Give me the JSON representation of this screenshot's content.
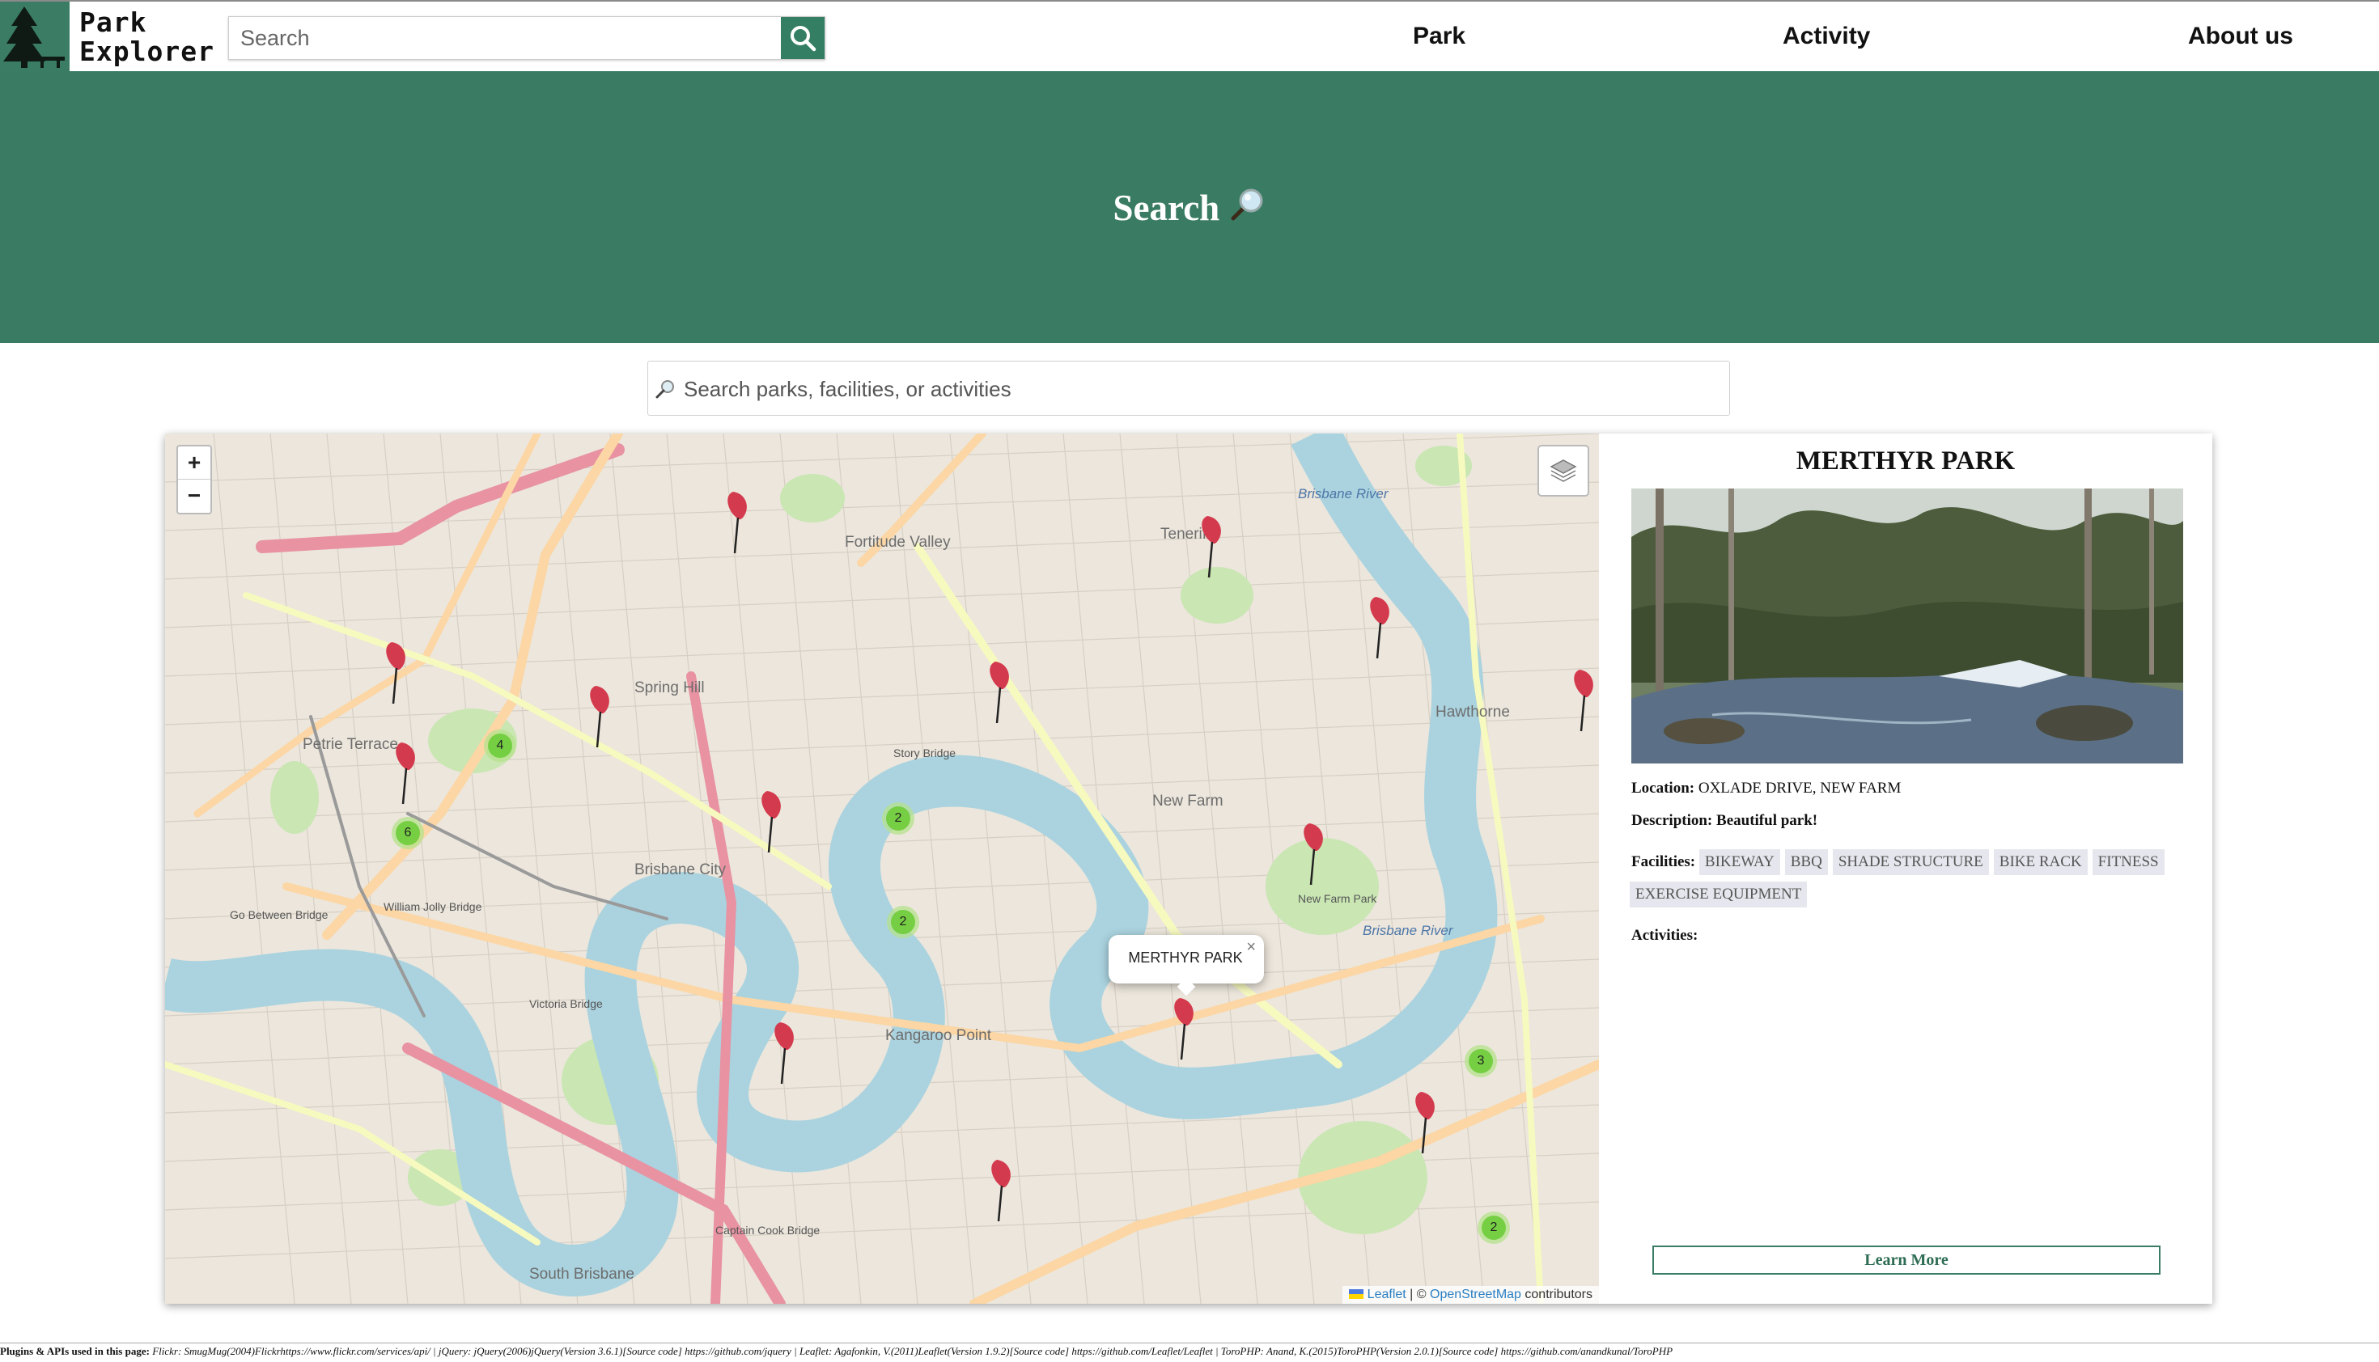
{
  "brand": {
    "line1": "Park",
    "line2": "Explorer"
  },
  "nav": {
    "search_placeholder": "Search",
    "links": [
      "Park",
      "Activity",
      "About us"
    ]
  },
  "hero": {
    "title": "Search"
  },
  "main_search": {
    "placeholder": "Search parks, facilities, or activities"
  },
  "map": {
    "zoom_in": "+",
    "zoom_out": "−",
    "attribution_leaflet": "Leaflet",
    "attribution_sep": " | © ",
    "attribution_osm": "OpenStreetMap",
    "attribution_tail": " contributors",
    "popup_title": "MERTHYR PARK",
    "popup_close": "×",
    "clusters": [
      "4",
      "6",
      "2",
      "2",
      "3",
      "2"
    ],
    "place_labels": {
      "fortitude_valley": "Fortitude Valley",
      "spring_hill": "Spring Hill",
      "petrie_terrace": "Petrie Terrace",
      "brisbane_city": "Brisbane City",
      "new_farm": "New Farm",
      "kangaroo_point": "Kangaroo Point",
      "south_brisbane": "South Brisbane",
      "hawthorne": "Hawthorne",
      "teneriffe": "Teneriffe",
      "brisbane_river": "Brisbane River",
      "story_bridge": "Story Bridge",
      "captain_cook_bridge": "Captain Cook Bridge",
      "victoria_bridge": "Victoria Bridge",
      "william_jolly_bridge": "William Jolly Bridge",
      "go_between_bridge": "Go Between Bridge",
      "new_farm_park": "New Farm Park"
    }
  },
  "panel": {
    "park_name": "MERTHYR PARK",
    "location_label": "Location:",
    "location_value": " OXLADE DRIVE, NEW FARM",
    "description_label": "Description:",
    "description_value": " Beautiful park!",
    "facilities_label": "Facilities:",
    "facilities": [
      "BIKEWAY",
      "BBQ",
      "SHADE STRUCTURE",
      "BIKE RACK",
      "FITNESS",
      "EXERCISE EQUIPMENT"
    ],
    "activities_label": "Activities:",
    "learn_more": "Learn More"
  },
  "footer": {
    "label": "Plugins & APIs used in this page:",
    "text": " Flickr: SmugMug(2004)Flickrhttps://www.flickr.com/services/api/ | jQuery: jQuery(2006)jQuery(Version 3.6.1)[Source code] https://github.com/jquery | Leaflet: Agafonkin, V.(2011)Leaflet(Version 1.9.2)[Source code] https://github.com/Leaflet/Leaflet | ToroPHP: Anand, K.(2015)ToroPHP(Version 2.0.1)[Source code] https://github.com/anandkunal/ToroPHP"
  },
  "colors": {
    "brand_green": "#3a7b64",
    "cluster": "#6ecc39",
    "pin": "#d43a4d"
  }
}
